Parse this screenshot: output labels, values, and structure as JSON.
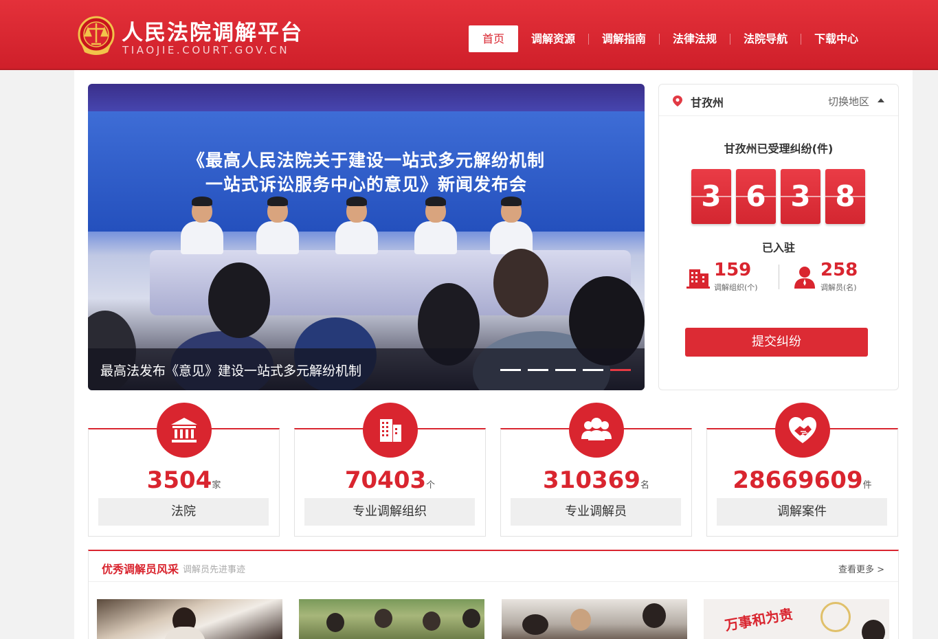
{
  "header": {
    "title": "人民法院调解平台",
    "subtitle": "TIAOJIE.COURT.GOV.CN",
    "nav": [
      "首页",
      "调解资源",
      "调解指南",
      "法律法规",
      "法院导航",
      "下载中心"
    ]
  },
  "banner": {
    "headline_line1": "《最高人民法院关于建设一站式多元解纷机制",
    "headline_line2": "一站式诉讼服务中心的意见》新闻发布会",
    "caption": "最高法发布《意见》建设一站式多元解纷机制",
    "slide_count": 5,
    "active_slide": 5
  },
  "region": {
    "name": "甘孜州",
    "switch_label": "切换地区",
    "accepted_label": "甘孜州已受理纠纷(件)",
    "accepted_digits": [
      "3",
      "6",
      "3",
      "8"
    ],
    "settled_label": "已入驻",
    "orgs": {
      "value": "159",
      "label": "调解组织(个)",
      "icon": "building-icon"
    },
    "mediators": {
      "value": "258",
      "label": "调解员(名)",
      "icon": "person-icon"
    },
    "submit_label": "提交纠纷"
  },
  "stats": [
    {
      "value": "3504",
      "unit": "家",
      "name": "法院",
      "icon": "court-icon"
    },
    {
      "value": "70403",
      "unit": "个",
      "name": "专业调解组织",
      "icon": "building-icon"
    },
    {
      "value": "310369",
      "unit": "名",
      "name": "专业调解员",
      "icon": "group-icon"
    },
    {
      "value": "28669609",
      "unit": "件",
      "name": "调解案件",
      "icon": "handshake-icon"
    }
  ],
  "section": {
    "title": "优秀调解员风采",
    "subtitle": "调解员先进事迹",
    "more": "查看更多 >",
    "thumb_banner_text": "万事和为贵"
  },
  "colors": {
    "brand": "#d9252f",
    "header": "#e4313a",
    "gold": "#f2c34a"
  }
}
